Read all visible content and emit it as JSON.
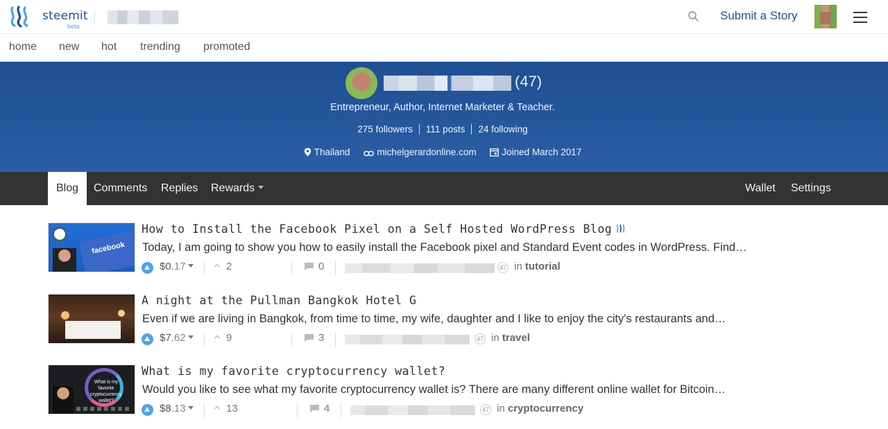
{
  "header": {
    "brand": "steemit",
    "beta": "beta",
    "submit_label": "Submit a Story",
    "icons": {
      "logo": "steemit-logo-icon",
      "search": "search-icon",
      "menu": "hamburger-menu-icon"
    }
  },
  "subnav": {
    "items": [
      {
        "label": "home"
      },
      {
        "label": "new"
      },
      {
        "label": "hot"
      },
      {
        "label": "trending"
      },
      {
        "label": "promoted"
      }
    ]
  },
  "profile": {
    "reputation": "(47)",
    "about": "Entrepreneur, Author, Internet Marketer & Teacher.",
    "followers": "275 followers",
    "posts": "111 posts",
    "following": "24 following",
    "location": "Thailand",
    "website": "michelgerardonline.com",
    "joined": "Joined March 2017",
    "banner_color": "#1f4f93"
  },
  "tabs": {
    "blog": "Blog",
    "comments": "Comments",
    "replies": "Replies",
    "rewards": "Rewards",
    "wallet": "Wallet",
    "settings": "Settings"
  },
  "posts": [
    {
      "title": "How to Install the Facebook Pixel on a Self Hosted WordPress Blog",
      "desc": "Today, I am going to show you how to easily install the Facebook pixel and Standard Event codes in WordPress. Find…",
      "payout_dollars": "$0.",
      "payout_cents": "17",
      "votes": "2",
      "comments": "0",
      "author_rep": "47",
      "in": "in",
      "category": "tutorial",
      "thumb_text": "facebook"
    },
    {
      "title": "A night at the Pullman Bangkok Hotel G",
      "desc": "Even if we are living in Bangkok, from time to time, my wife, daughter and I like to enjoy the city's restaurants and…",
      "payout_dollars": "$7.",
      "payout_cents": "62",
      "votes": "9",
      "comments": "3",
      "author_rep": "47",
      "in": "in",
      "category": "travel"
    },
    {
      "title": "What is my favorite cryptocurrency wallet?",
      "desc": "Would you like to see what my favorite cryptocurrency wallet is? There are many different online wallet for Bitcoin…",
      "payout_dollars": "$8.",
      "payout_cents": "13",
      "votes": "13",
      "comments": "4",
      "author_rep": "47",
      "in": "in",
      "category": "cryptocurrency",
      "thumb_text": "What is my favorite cryptocurrency wallet?"
    }
  ],
  "colors": {
    "accent": "#1a5099",
    "vote": "#4ba2f2",
    "tabbar": "#333333"
  }
}
